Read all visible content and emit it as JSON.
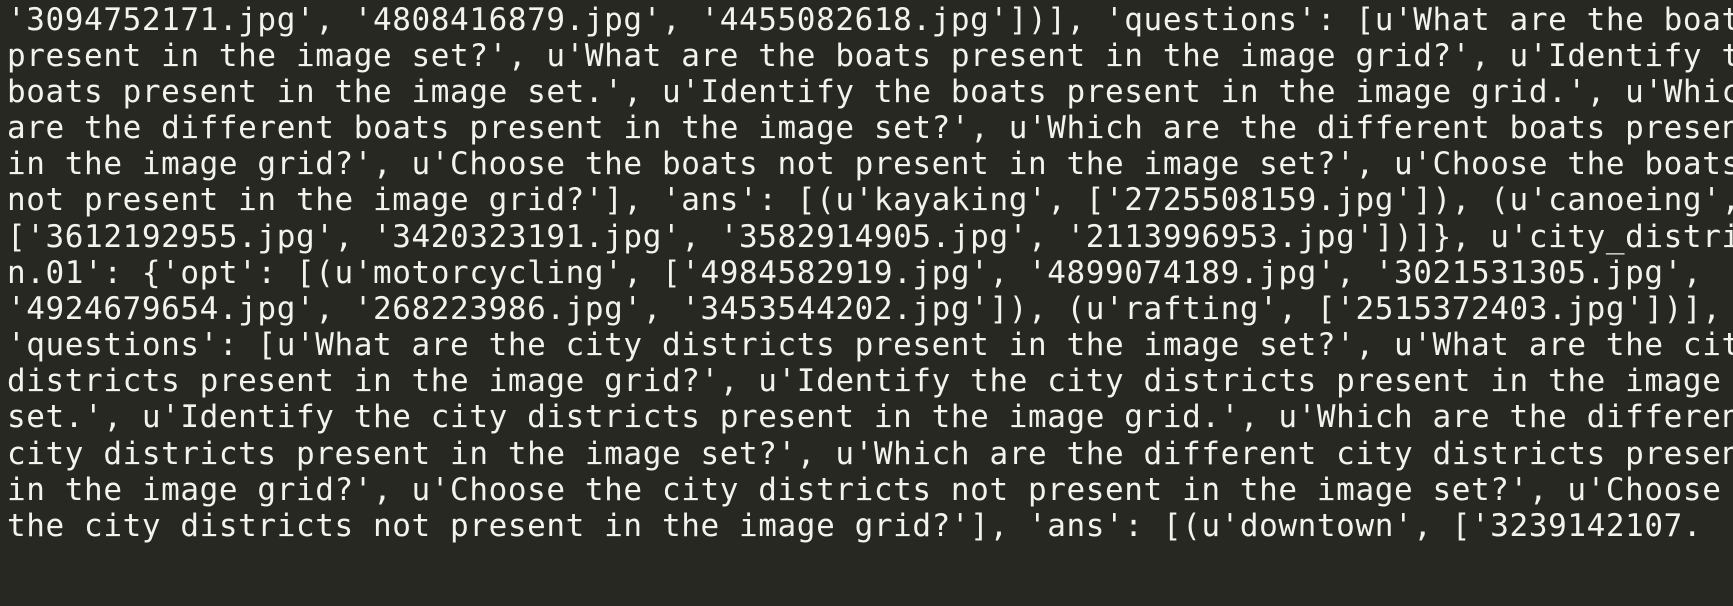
{
  "terminal": {
    "lines": [
      "'3094752171.jpg', '4808416879.jpg', '4455082618.jpg'])], 'questions': [u'What are the boats",
      "present in the image set?', u'What are the boats present in the image grid?', u'Identify the",
      "boats present in the image set.', u'Identify the boats present in the image grid.', u'Which",
      "are the different boats present in the image set?', u'Which are the different boats present",
      "in the image grid?', u'Choose the boats not present in the image set?', u'Choose the boats",
      "not present in the image grid?'], 'ans': [(u'kayaking', ['2725508159.jpg']), (u'canoeing',",
      "['3612192955.jpg', '3420323191.jpg', '3582914905.jpg', '2113996953.jpg'])]}, u'city_district.",
      "n.01': {'opt': [(u'motorcycling', ['4984582919.jpg', '4899074189.jpg', '3021531305.jpg',",
      "'4924679654.jpg', '268223986.jpg', '3453544202.jpg']), (u'rafting', ['2515372403.jpg'])],",
      "'questions': [u'What are the city districts present in the image set?', u'What are the city",
      "districts present in the image grid?', u'Identify the city districts present in the image",
      "set.', u'Identify the city districts present in the image grid.', u'Which are the different",
      "city districts present in the image set?', u'Which are the different city districts present",
      "in the image grid?', u'Choose the city districts not present in the image set?', u'Choose",
      "the city districts not present in the image grid?'], 'ans': [(u'downtown', ['3239142107."
    ]
  }
}
